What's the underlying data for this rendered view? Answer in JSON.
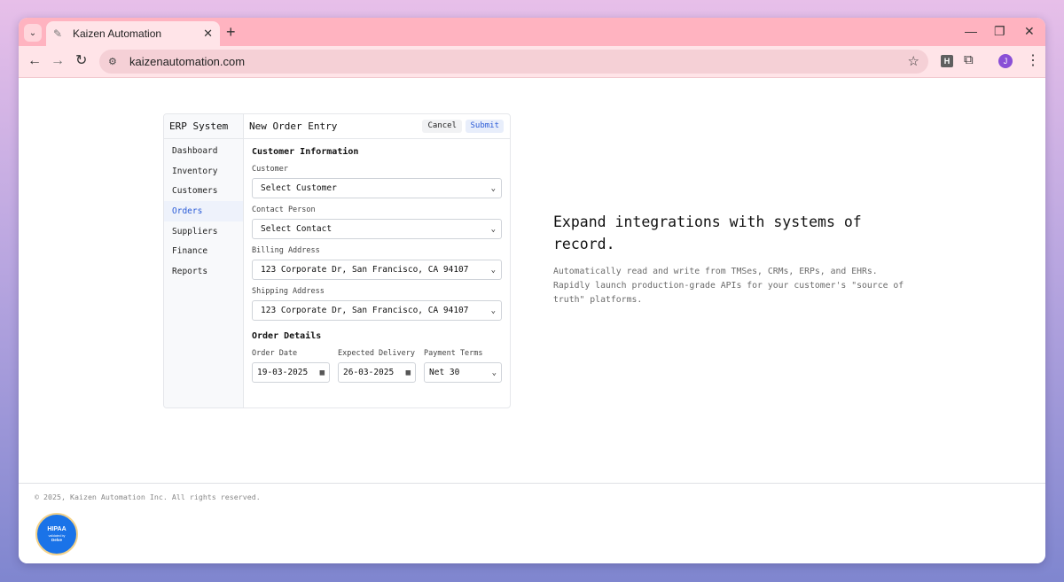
{
  "browser": {
    "tab_title": "Kaizen Automation",
    "url": "kaizenautomation.com",
    "profile_initial": "J",
    "extension_letter": "H"
  },
  "erp": {
    "brand": "ERP System",
    "nav": [
      {
        "label": "Dashboard",
        "active": false
      },
      {
        "label": "Inventory",
        "active": false
      },
      {
        "label": "Customers",
        "active": false
      },
      {
        "label": "Orders",
        "active": true
      },
      {
        "label": "Suppliers",
        "active": false
      },
      {
        "label": "Finance",
        "active": false
      },
      {
        "label": "Reports",
        "active": false
      }
    ],
    "header_title": "New Order Entry",
    "cancel_label": "Cancel",
    "submit_label": "Submit",
    "customer_section": {
      "title": "Customer Information",
      "customer_label": "Customer",
      "customer_value": "Select Customer",
      "contact_label": "Contact Person",
      "contact_value": "Select Contact",
      "billing_label": "Billing Address",
      "billing_value": "123 Corporate Dr, San Francisco, CA 94107",
      "shipping_label": "Shipping Address",
      "shipping_value": "123 Corporate Dr, San Francisco, CA 94107"
    },
    "order_section": {
      "title": "Order Details",
      "order_date_label": "Order Date",
      "order_date_value": "19-03-2025",
      "delivery_label": "Expected Delivery",
      "delivery_value": "26-03-2025",
      "terms_label": "Payment Terms",
      "terms_value": "Net 30"
    }
  },
  "hero": {
    "title": "Expand integrations with systems of record.",
    "subtitle": "Automatically read and write from TMSes, CRMs, ERPs, and EHRs. Rapidly launch production-grade APIs for your customer's \"source of truth\" platforms."
  },
  "footer": {
    "copyright": "© 2025, Kaizen Automation Inc. All rights reserved.",
    "badge_line1": "HIPAA",
    "badge_line2": "validated by",
    "badge_line3": "Delve"
  }
}
